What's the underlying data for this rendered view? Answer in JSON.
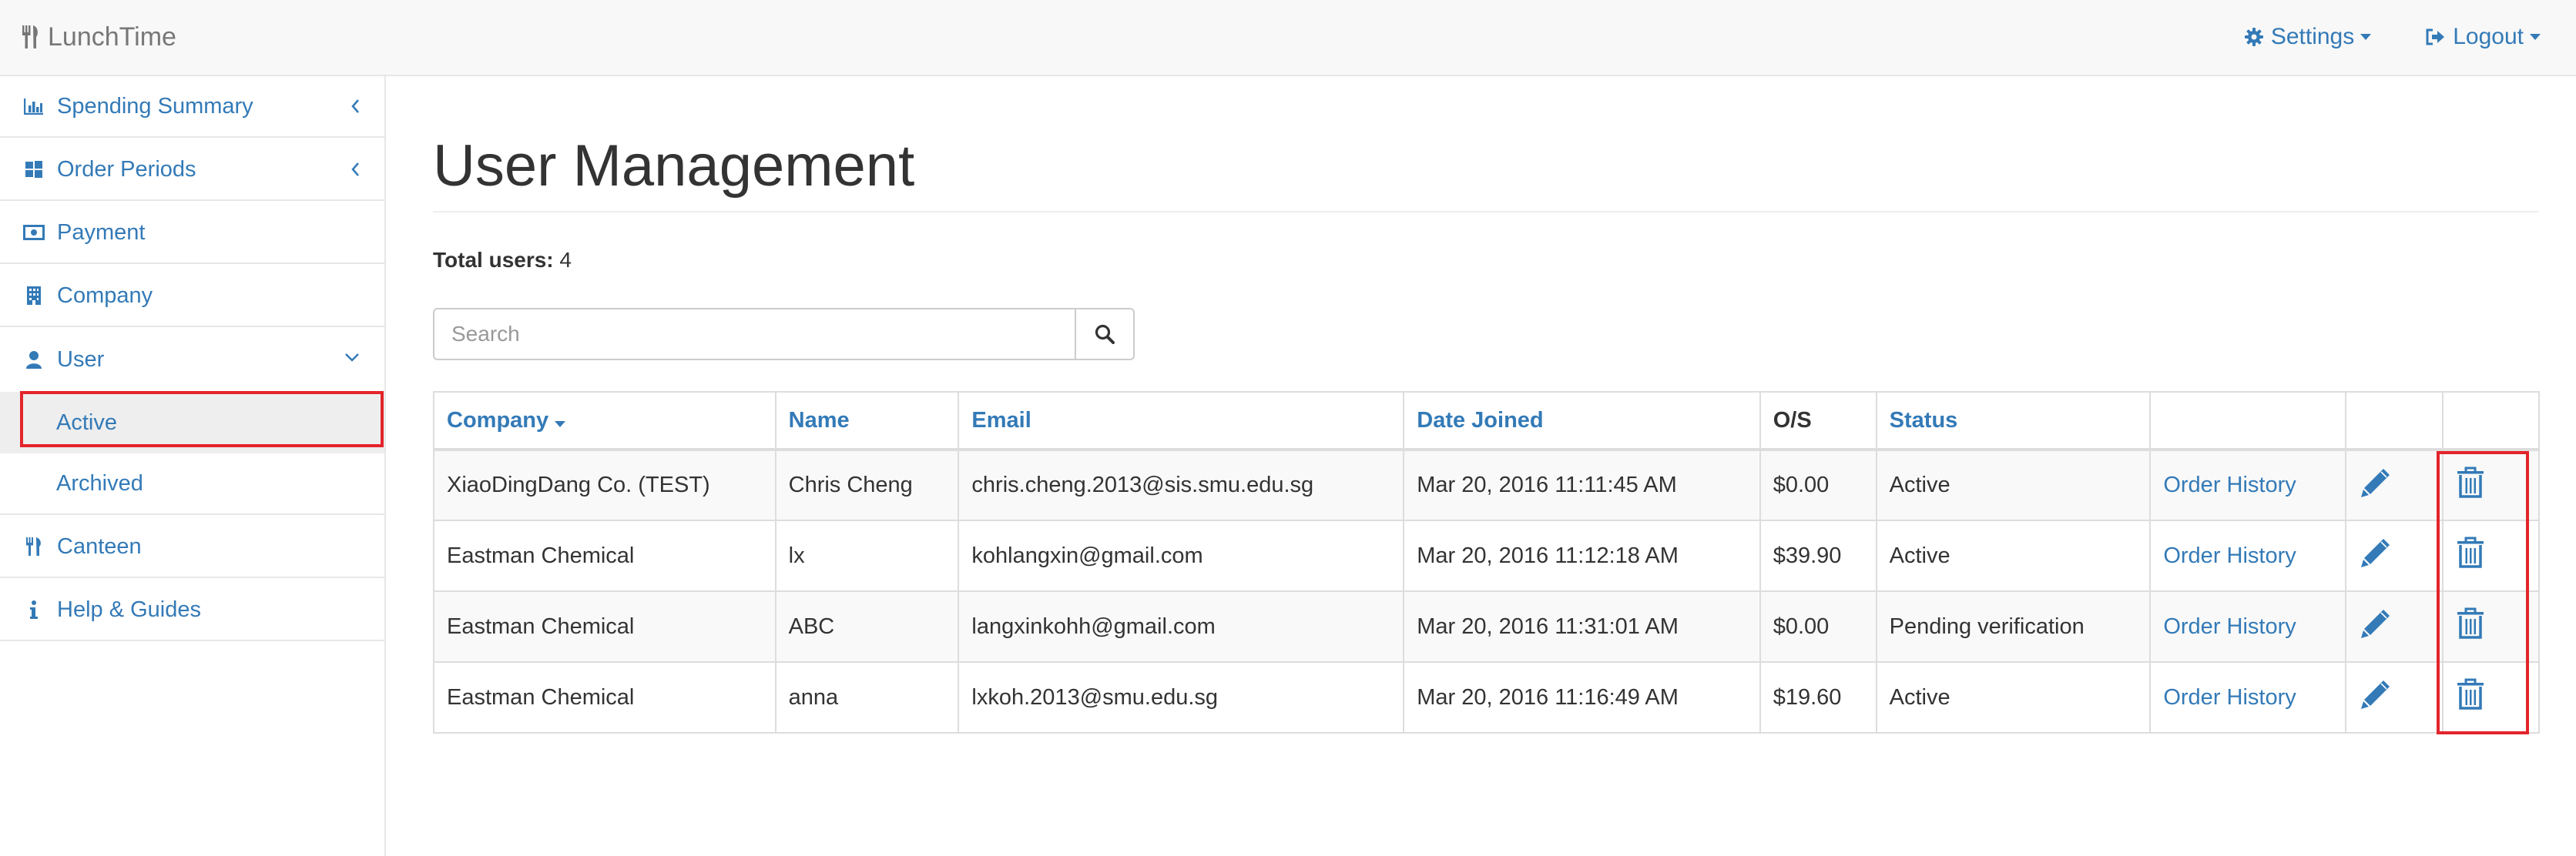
{
  "app": {
    "title": "LunchTime"
  },
  "nav": {
    "settings_label": "Settings",
    "logout_label": "Logout"
  },
  "sidebar": {
    "items": [
      {
        "label": "Spending Summary",
        "icon": "bar-chart-icon",
        "expandable": true
      },
      {
        "label": "Order Periods",
        "icon": "windows-icon",
        "expandable": true
      },
      {
        "label": "Payment",
        "icon": "money-icon"
      },
      {
        "label": "Company",
        "icon": "building-icon"
      },
      {
        "label": "User",
        "icon": "user-icon",
        "expanded": true
      },
      {
        "label": "Canteen",
        "icon": "cutlery-icon"
      },
      {
        "label": "Help & Guides",
        "icon": "info-icon"
      }
    ],
    "user_subitems": [
      {
        "label": "Active",
        "selected": true
      },
      {
        "label": "Archived"
      }
    ]
  },
  "main": {
    "title": "User Management",
    "total_label": "Total users:",
    "total_value": "4",
    "search_placeholder": "Search"
  },
  "table": {
    "headers": [
      "Company",
      "Name",
      "Email",
      "Date Joined",
      "O/S",
      "Status"
    ],
    "sorted_column": "Company",
    "rows": [
      {
        "company": "XiaoDingDang Co. (TEST)",
        "name": "Chris Cheng",
        "email": "chris.cheng.2013@sis.smu.edu.sg",
        "date_joined": "Mar 20, 2016 11:11:45 AM",
        "os": "$0.00",
        "status": "Active",
        "history": "Order History"
      },
      {
        "company": "Eastman Chemical",
        "name": "lx",
        "email": "kohlangxin@gmail.com",
        "date_joined": "Mar 20, 2016 11:12:18 AM",
        "os": "$39.90",
        "status": "Active",
        "history": "Order History"
      },
      {
        "company": "Eastman Chemical",
        "name": "ABC",
        "email": "langxinkohh@gmail.com",
        "date_joined": "Mar 20, 2016 11:31:01 AM",
        "os": "$0.00",
        "status": "Pending verification",
        "history": "Order History"
      },
      {
        "company": "Eastman Chemical",
        "name": "anna",
        "email": "lxkoh.2013@smu.edu.sg",
        "date_joined": "Mar 20, 2016 11:16:49 AM",
        "os": "$19.60",
        "status": "Active",
        "history": "Order History"
      }
    ]
  },
  "colors": {
    "link": "#337ab7",
    "highlight": "#e3242b",
    "navbar_bg": "#f8f8f8"
  }
}
